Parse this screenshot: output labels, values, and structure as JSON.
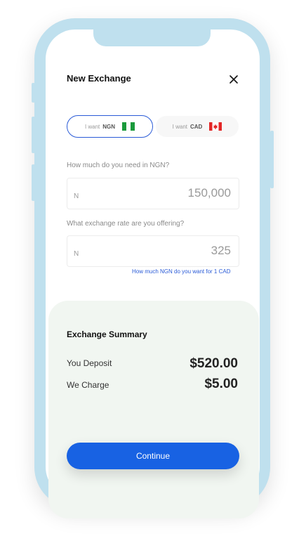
{
  "header": {
    "title": "New Exchange",
    "close_icon": "close-icon"
  },
  "toggle": {
    "options": [
      {
        "prefix": "I want",
        "currency": "NGN",
        "flag": "nigeria-flag-icon",
        "active": true
      },
      {
        "prefix": "I want",
        "currency": "CAD",
        "flag": "canada-flag-icon",
        "active": false
      }
    ]
  },
  "need_field": {
    "question": "How much do you need in NGN?",
    "prefix": "N",
    "value": "150,000"
  },
  "rate_field": {
    "question": "What exchange rate are you offering?",
    "prefix": "N",
    "value": "325",
    "hint": "How much NGN do you want for 1 CAD"
  },
  "summary": {
    "title": "Exchange Summary",
    "rows": [
      {
        "label": "You Deposit",
        "value": "$520.00"
      },
      {
        "label": "We Charge",
        "value": "$5.00"
      }
    ]
  },
  "actions": {
    "continue_label": "Continue"
  },
  "colors": {
    "accent": "#1862e3",
    "frame": "#bfe0ee",
    "summary_bg": "#f1f6f1"
  }
}
